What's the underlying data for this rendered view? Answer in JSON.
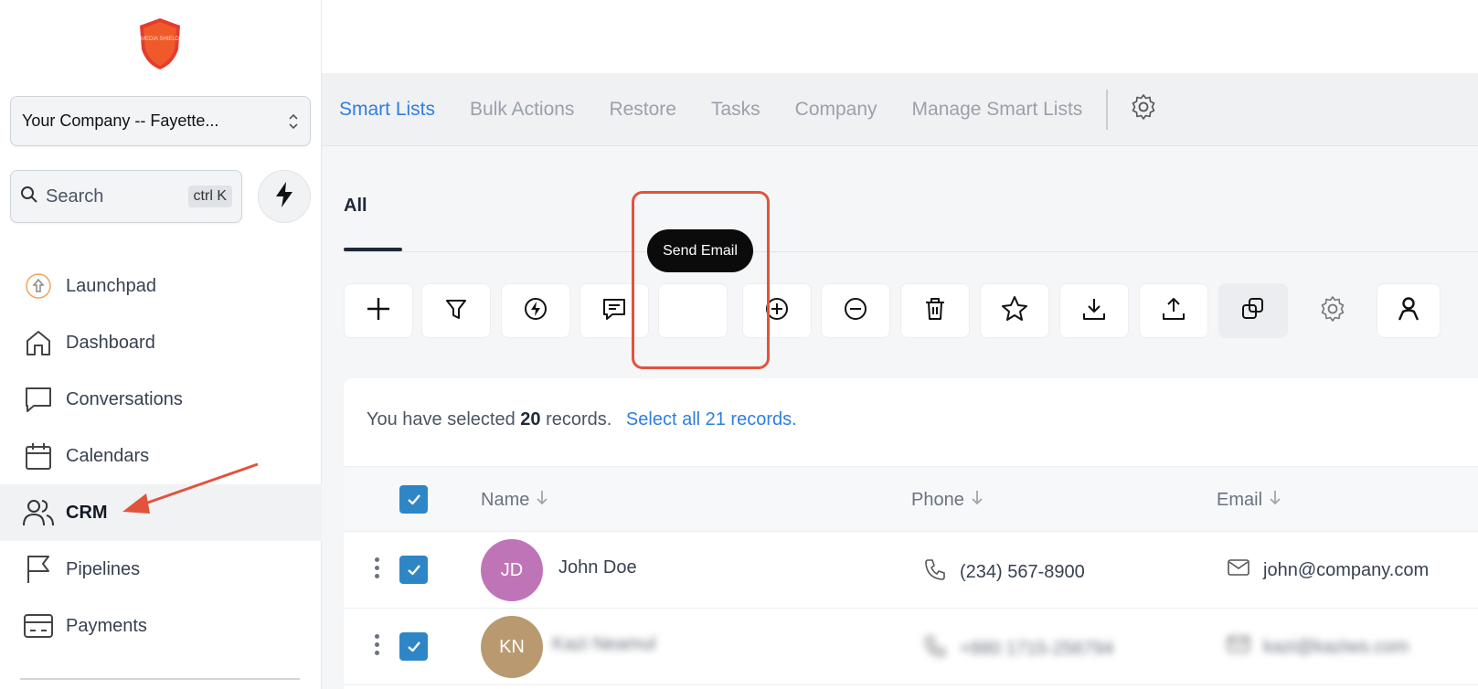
{
  "sidebar": {
    "logo_text": "MEDIA SHIELD",
    "company_selector": "Your Company -- Fayette...",
    "search": {
      "placeholder": "Search",
      "shortcut": "ctrl K"
    },
    "nav_items": [
      {
        "label": "Launchpad",
        "icon": "launchpad-icon"
      },
      {
        "label": "Dashboard",
        "icon": "home-icon"
      },
      {
        "label": "Conversations",
        "icon": "chat-icon"
      },
      {
        "label": "Calendars",
        "icon": "calendar-icon"
      },
      {
        "label": "CRM",
        "icon": "users-icon",
        "active": true
      },
      {
        "label": "Pipelines",
        "icon": "flag-icon"
      },
      {
        "label": "Payments",
        "icon": "card-icon"
      }
    ]
  },
  "tabs": [
    "Smart Lists",
    "Bulk Actions",
    "Restore",
    "Tasks",
    "Company",
    "Manage Smart Lists"
  ],
  "active_tab": "Smart Lists",
  "subtab": "All",
  "toolbar": {
    "tooltip": "Send Email",
    "buttons": [
      "add",
      "filter",
      "run-automation",
      "send-sms",
      "send-email",
      "add-tag",
      "remove-tag",
      "delete",
      "review",
      "export",
      "import",
      "merge",
      "settings",
      "user"
    ]
  },
  "selection": {
    "prefix": "You have selected",
    "count": "20",
    "suffix": "records.",
    "link": "Select all 21 records."
  },
  "table": {
    "columns": [
      "Name",
      "Phone",
      "Email"
    ],
    "rows": [
      {
        "initials": "JD",
        "avatar_color": "#c074b8",
        "name": "John Doe",
        "phone": "(234) 567-8900",
        "email": "john@company.com"
      },
      {
        "initials": "KN",
        "avatar_color": "#b99a70",
        "name": "Kazi Neamul",
        "phone": "+880 1715-256794",
        "email": "kazi@kaziws.com"
      }
    ]
  },
  "colors": {
    "accent": "#2f7ee0",
    "highlight": "#e0543c",
    "checkbox": "#2f86c6"
  }
}
